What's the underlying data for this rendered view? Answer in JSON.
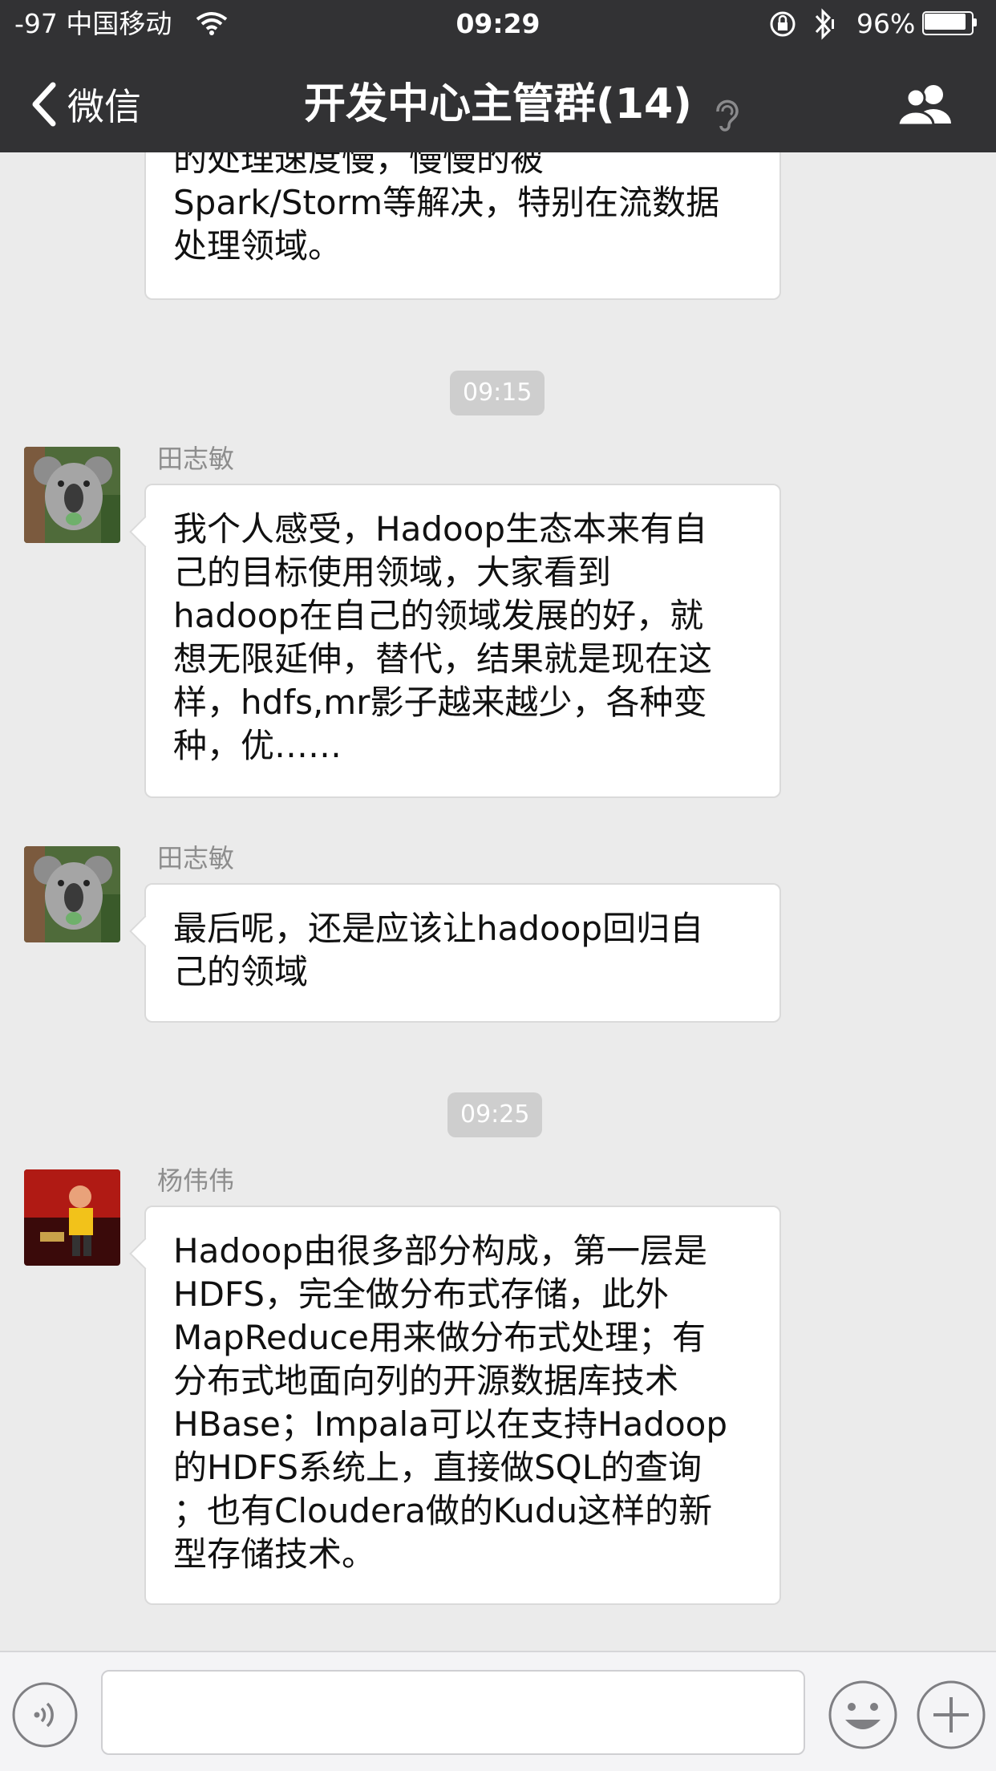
{
  "status_bar": {
    "carrier": "-97 中国移动",
    "time": "09:29",
    "battery": "96%"
  },
  "nav": {
    "back_label": "微信",
    "title": "开发中心主管群(14)"
  },
  "messages": {
    "first_partial_text": "的处理速度慢，慢慢的被\nSpark/Storm等解决，特别在流数据\n处理领域。",
    "time_1": "09:15",
    "msg1_sender": "田志敏",
    "msg1_text": "我个人感受，Hadoop生态本来有自\n己的目标使用领域，大家看到\nhadoop在自己的领域发展的好，就\n想无限延伸，替代，结果就是现在这\n样，hdfs,mr影子越来越少，各种变\n种，优……",
    "msg2_sender": "田志敏",
    "msg2_text": "最后呢，还是应该让hadoop回归自\n己的领域",
    "time_2": "09:25",
    "msg3_sender": "杨伟伟",
    "msg3_text": "Hadoop由很多部分构成，第一层是\nHDFS，完全做分布式存储，此外\nMapReduce用来做分布式处理；有\n分布式地面向列的开源数据库技术\nHBase；Impala可以在支持Hadoop\n的HDFS系统上，直接做SQL的查询\n；也有Cloudera做的Kudu这样的新\n型存储技术。"
  },
  "input": {
    "value": ""
  },
  "icons": {
    "back": "chevron-left-icon",
    "members": "group-members-icon",
    "voice": "voice-input-icon",
    "emoji": "emoji-icon",
    "plus": "plus-icon"
  },
  "colors": {
    "nav_bg": "#323234",
    "chat_bg": "#ebebeb",
    "bubble_bg": "#ffffff",
    "time_badge": "#cecece"
  }
}
